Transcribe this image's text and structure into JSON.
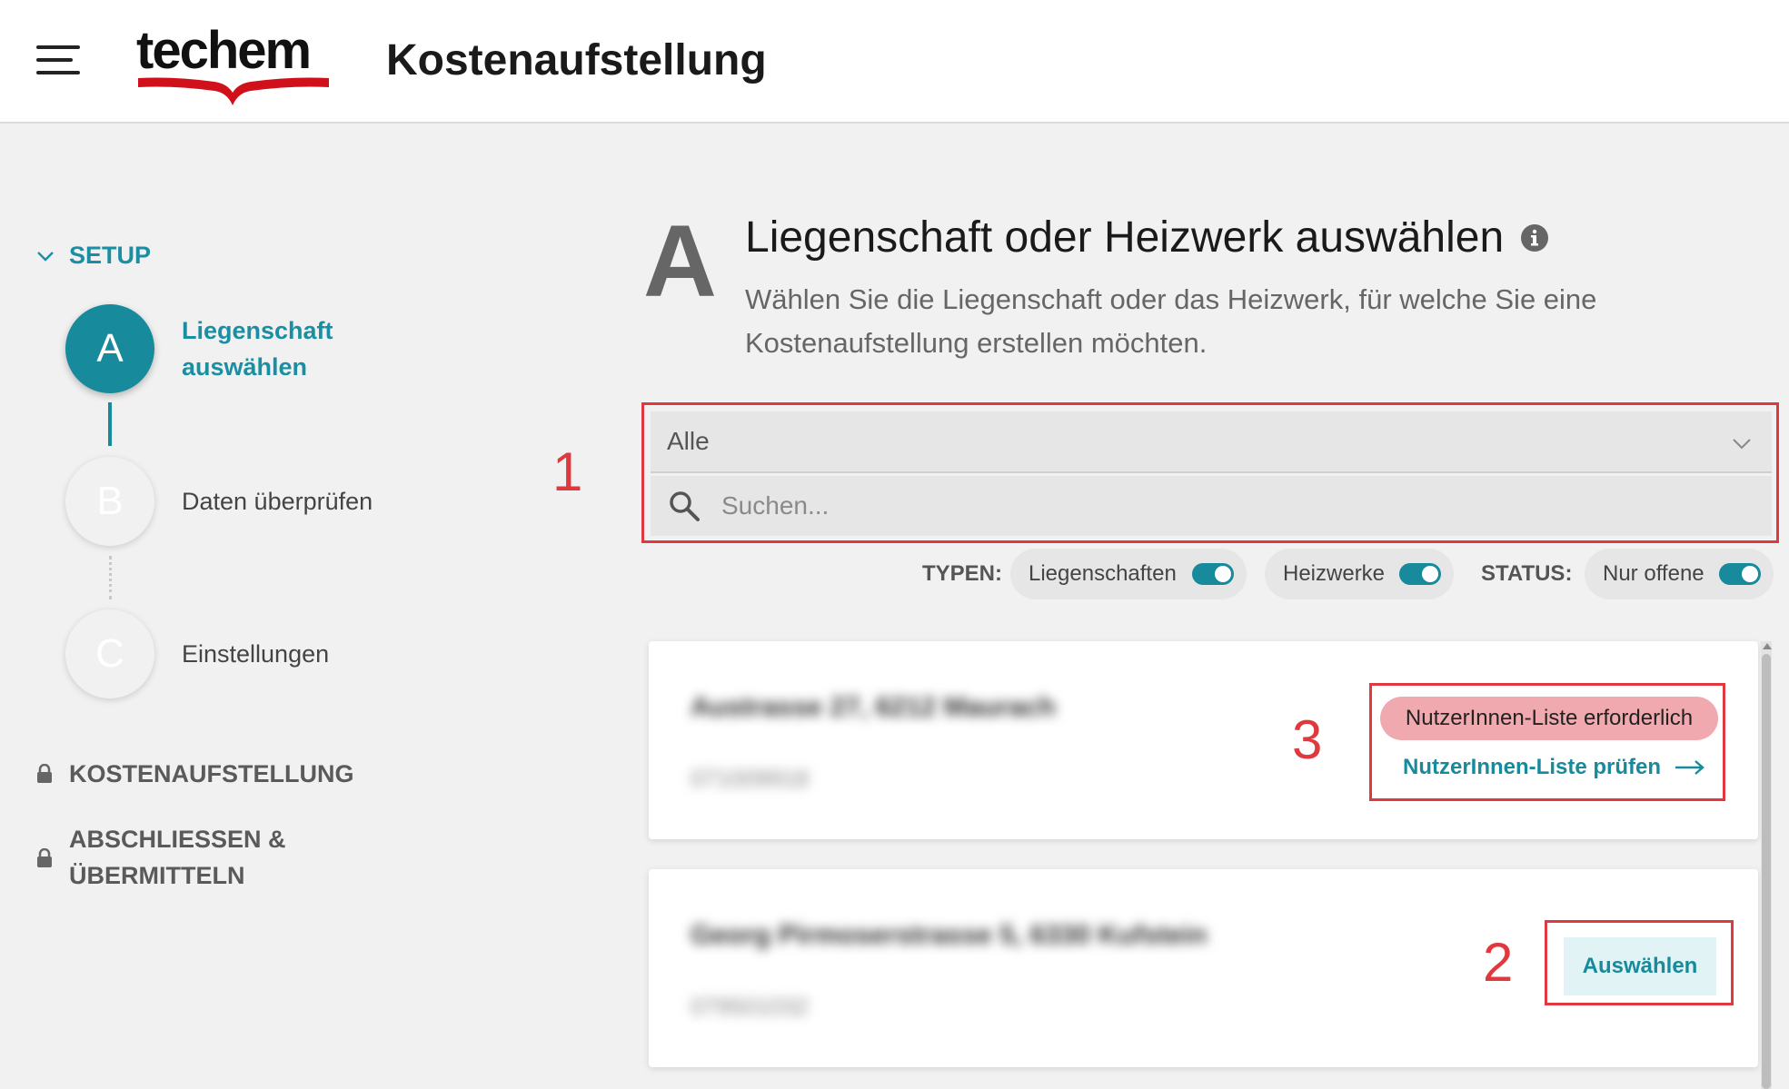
{
  "header": {
    "logo_text": "techem",
    "title": "Kostenaufstellung",
    "accent_color": "#d0101a"
  },
  "sidebar": {
    "setup_label": "SETUP",
    "steps": [
      {
        "letter": "A",
        "label": "Liegenschaft auswählen",
        "state": "active"
      },
      {
        "letter": "B",
        "label": "Daten überprüfen",
        "state": "inactive"
      },
      {
        "letter": "C",
        "label": "Einstellungen",
        "state": "inactive"
      }
    ],
    "locked_sections": [
      {
        "label": "KOSTENAUFSTELLUNG"
      },
      {
        "label": "ABSCHLIESSEN & ÜBERMITTELN"
      }
    ]
  },
  "main": {
    "step_letter": "A",
    "title": "Liegenschaft oder Heizwerk auswählen",
    "description": "Wählen Sie die Liegenschaft oder das Heizwerk, für welche Sie eine Kostenaufstellung erstellen möchten.",
    "dropdown_value": "Alle",
    "search_placeholder": "Suchen...",
    "filters": {
      "types_label": "TYPEN:",
      "status_label": "STATUS:",
      "chips": [
        {
          "label": "Liegenschaften",
          "on": true
        },
        {
          "label": "Heizwerke",
          "on": true
        },
        {
          "label": "Nur offene",
          "on": true
        }
      ]
    },
    "cards": [
      {
        "address": "Austrasse 27, 6212 Maurach",
        "number": "071009918",
        "badge": "NutzerInnen-Liste erforderlich",
        "link": "NutzerInnen-Liste prüfen"
      },
      {
        "address": "Georg Pirmoserstrasse 5, 6330 Kufstein",
        "number": "079501032",
        "button": "Auswählen"
      }
    ]
  },
  "annotations": {
    "one": "1",
    "two": "2",
    "three": "3",
    "color": "#e0383f"
  },
  "colors": {
    "primary": "#178a9c",
    "badge_bg": "#f0a9ae",
    "button_bg": "#e1f3f5"
  }
}
